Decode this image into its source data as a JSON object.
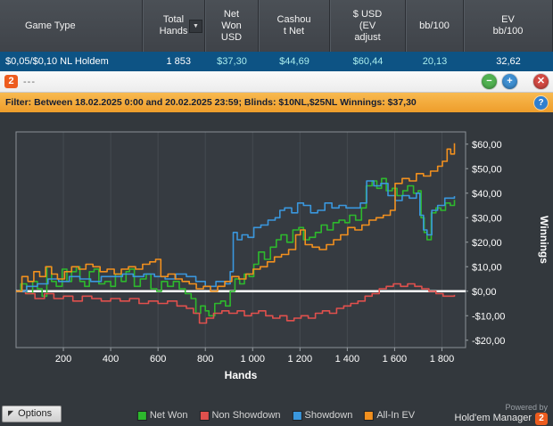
{
  "table": {
    "columns": [
      "Game Type",
      "Total\nHands",
      "Net\nWon\nUSD",
      "Cashou\nt Net",
      "$ USD\n(EV\nadjust",
      "bb/100",
      "EV\nbb/100"
    ],
    "sort_glyph": "▼",
    "row": [
      "$0,05/$0,10 NL Holdem",
      "1 853",
      "$37,30",
      "$44,69",
      "$60,44",
      "20,13",
      "32,62"
    ]
  },
  "toolbar": {
    "app_badge": "2",
    "title": "---",
    "minus_glyph": "−",
    "plus_glyph": "+",
    "close_glyph": "✕"
  },
  "filter_bar": {
    "label": "Filter: Between 18.02.2025 0:00 and 20.02.2025 23:59; Blinds: $10NL,$25NL Winnings: $37,30",
    "help_glyph": "?"
  },
  "chart_data": {
    "type": "line",
    "title": "",
    "xlabel": "Hands",
    "ylabel": "Winnings",
    "xlim": [
      0,
      1900
    ],
    "ylim": [
      -23,
      65
    ],
    "grid": "vertical-only",
    "zero_line_color": "#ffffff",
    "plot_bg": "#363b41",
    "grid_color": "#454b51",
    "border_color": "#8b9198",
    "legend_position": "bottom",
    "x_ticks": [
      {
        "value": 200,
        "label": "200"
      },
      {
        "value": 400,
        "label": "400"
      },
      {
        "value": 600,
        "label": "600"
      },
      {
        "value": 800,
        "label": "800"
      },
      {
        "value": 1000,
        "label": "1 000"
      },
      {
        "value": 1200,
        "label": "1 200"
      },
      {
        "value": 1400,
        "label": "1 400"
      },
      {
        "value": 1600,
        "label": "1 600"
      },
      {
        "value": 1800,
        "label": "1 800"
      }
    ],
    "y_ticks": [
      {
        "value": 60,
        "label": "$60,00"
      },
      {
        "value": 50,
        "label": "$50,00"
      },
      {
        "value": 40,
        "label": "$40,00"
      },
      {
        "value": 30,
        "label": "$30,00"
      },
      {
        "value": 20,
        "label": "$20,00"
      },
      {
        "value": 10,
        "label": "$10,00"
      },
      {
        "value": 0,
        "label": "$0,00"
      },
      {
        "value": -10,
        "label": "-$10,00"
      },
      {
        "value": -20,
        "label": "-$20,00"
      }
    ],
    "series": [
      {
        "name": "Net Won",
        "color": "#2db92d",
        "final_value": 37.3,
        "points": [
          [
            0,
            0
          ],
          [
            20,
            3
          ],
          [
            45,
            -1
          ],
          [
            70,
            4
          ],
          [
            90,
            1
          ],
          [
            110,
            -2
          ],
          [
            130,
            10
          ],
          [
            150,
            4
          ],
          [
            170,
            2
          ],
          [
            195,
            9
          ],
          [
            215,
            4
          ],
          [
            235,
            8
          ],
          [
            255,
            10
          ],
          [
            270,
            4
          ],
          [
            290,
            2
          ],
          [
            310,
            8
          ],
          [
            330,
            9
          ],
          [
            350,
            3
          ],
          [
            375,
            4
          ],
          [
            400,
            2
          ],
          [
            420,
            7
          ],
          [
            445,
            4
          ],
          [
            465,
            8
          ],
          [
            480,
            9
          ],
          [
            500,
            2
          ],
          [
            525,
            5
          ],
          [
            550,
            7
          ],
          [
            570,
            1
          ],
          [
            595,
            0
          ],
          [
            615,
            4
          ],
          [
            640,
            2
          ],
          [
            665,
            4
          ],
          [
            690,
            1
          ],
          [
            715,
            -1
          ],
          [
            740,
            -3
          ],
          [
            760,
            -9
          ],
          [
            780,
            -6
          ],
          [
            800,
            -8
          ],
          [
            815,
            -10
          ],
          [
            840,
            -5
          ],
          [
            865,
            -4
          ],
          [
            885,
            -6
          ],
          [
            905,
            0
          ],
          [
            925,
            5
          ],
          [
            945,
            3
          ],
          [
            965,
            7
          ],
          [
            985,
            6
          ],
          [
            1005,
            11
          ],
          [
            1025,
            16
          ],
          [
            1050,
            13
          ],
          [
            1075,
            18
          ],
          [
            1100,
            21
          ],
          [
            1120,
            23
          ],
          [
            1145,
            20
          ],
          [
            1170,
            25
          ],
          [
            1195,
            26
          ],
          [
            1215,
            21
          ],
          [
            1240,
            22
          ],
          [
            1265,
            24
          ],
          [
            1290,
            27
          ],
          [
            1315,
            25
          ],
          [
            1340,
            28
          ],
          [
            1365,
            29
          ],
          [
            1390,
            28
          ],
          [
            1410,
            31
          ],
          [
            1435,
            29
          ],
          [
            1460,
            34
          ],
          [
            1480,
            43
          ],
          [
            1505,
            45
          ],
          [
            1525,
            42
          ],
          [
            1545,
            46
          ],
          [
            1565,
            41
          ],
          [
            1590,
            42
          ],
          [
            1610,
            39
          ],
          [
            1635,
            41
          ],
          [
            1655,
            43
          ],
          [
            1680,
            40
          ],
          [
            1700,
            41
          ],
          [
            1712,
            30
          ],
          [
            1725,
            24
          ],
          [
            1737,
            21
          ],
          [
            1755,
            32
          ],
          [
            1775,
            34
          ],
          [
            1795,
            33
          ],
          [
            1815,
            36
          ],
          [
            1835,
            35
          ],
          [
            1853,
            37.3
          ]
        ]
      },
      {
        "name": "Non Showdown",
        "color": "#e0504d",
        "points": [
          [
            0,
            0
          ],
          [
            40,
            -1
          ],
          [
            80,
            -3
          ],
          [
            120,
            -1
          ],
          [
            160,
            -3
          ],
          [
            200,
            -2
          ],
          [
            240,
            -4
          ],
          [
            280,
            -2
          ],
          [
            320,
            -3
          ],
          [
            360,
            -4
          ],
          [
            400,
            -3
          ],
          [
            440,
            -4
          ],
          [
            480,
            -3
          ],
          [
            520,
            -5
          ],
          [
            560,
            -4
          ],
          [
            600,
            -5
          ],
          [
            640,
            -4
          ],
          [
            680,
            -6
          ],
          [
            720,
            -7
          ],
          [
            750,
            -9
          ],
          [
            775,
            -13
          ],
          [
            805,
            -11
          ],
          [
            835,
            -9
          ],
          [
            870,
            -8
          ],
          [
            900,
            -9
          ],
          [
            935,
            -8
          ],
          [
            965,
            -10
          ],
          [
            995,
            -9
          ],
          [
            1025,
            -8
          ],
          [
            1055,
            -10
          ],
          [
            1085,
            -11
          ],
          [
            1115,
            -10
          ],
          [
            1145,
            -12
          ],
          [
            1175,
            -11
          ],
          [
            1205,
            -10
          ],
          [
            1235,
            -11
          ],
          [
            1265,
            -9
          ],
          [
            1295,
            -8
          ],
          [
            1325,
            -9
          ],
          [
            1355,
            -7
          ],
          [
            1385,
            -6
          ],
          [
            1415,
            -5
          ],
          [
            1445,
            -4
          ],
          [
            1475,
            -2
          ],
          [
            1505,
            -1
          ],
          [
            1535,
            1
          ],
          [
            1565,
            2
          ],
          [
            1595,
            3
          ],
          [
            1625,
            2
          ],
          [
            1655,
            3
          ],
          [
            1685,
            2
          ],
          [
            1715,
            1
          ],
          [
            1745,
            0
          ],
          [
            1775,
            -1
          ],
          [
            1805,
            -2
          ],
          [
            1853,
            -1.5
          ]
        ]
      },
      {
        "name": "Showdown",
        "color": "#3a97dd",
        "points": [
          [
            0,
            0
          ],
          [
            45,
            2
          ],
          [
            90,
            3
          ],
          [
            135,
            5
          ],
          [
            180,
            4
          ],
          [
            225,
            6
          ],
          [
            270,
            5
          ],
          [
            315,
            4
          ],
          [
            360,
            6
          ],
          [
            405,
            6
          ],
          [
            450,
            7
          ],
          [
            495,
            6
          ],
          [
            540,
            7
          ],
          [
            585,
            6
          ],
          [
            630,
            5
          ],
          [
            675,
            7
          ],
          [
            720,
            6
          ],
          [
            760,
            4
          ],
          [
            800,
            2
          ],
          [
            845,
            4
          ],
          [
            885,
            3
          ],
          [
            905,
            8
          ],
          [
            918,
            24
          ],
          [
            935,
            21
          ],
          [
            955,
            23
          ],
          [
            980,
            22
          ],
          [
            1005,
            26
          ],
          [
            1035,
            27
          ],
          [
            1065,
            29
          ],
          [
            1095,
            30
          ],
          [
            1115,
            33
          ],
          [
            1135,
            34
          ],
          [
            1165,
            32
          ],
          [
            1190,
            36
          ],
          [
            1215,
            35
          ],
          [
            1245,
            32
          ],
          [
            1275,
            33
          ],
          [
            1305,
            36
          ],
          [
            1335,
            34
          ],
          [
            1365,
            35
          ],
          [
            1395,
            34
          ],
          [
            1425,
            34
          ],
          [
            1455,
            36
          ],
          [
            1482,
            45
          ],
          [
            1512,
            43
          ],
          [
            1542,
            44
          ],
          [
            1572,
            39
          ],
          [
            1602,
            37
          ],
          [
            1632,
            39
          ],
          [
            1662,
            38
          ],
          [
            1692,
            40
          ],
          [
            1707,
            31
          ],
          [
            1722,
            25
          ],
          [
            1737,
            23
          ],
          [
            1757,
            33
          ],
          [
            1782,
            35
          ],
          [
            1812,
            38
          ],
          [
            1853,
            38.8
          ]
        ]
      },
      {
        "name": "All-In EV",
        "color": "#f2901e",
        "final_value": 60.44,
        "points": [
          [
            0,
            0
          ],
          [
            25,
            6
          ],
          [
            50,
            4
          ],
          [
            75,
            8
          ],
          [
            100,
            6
          ],
          [
            125,
            10
          ],
          [
            150,
            7
          ],
          [
            175,
            5
          ],
          [
            205,
            8
          ],
          [
            235,
            10
          ],
          [
            265,
            9
          ],
          [
            295,
            11
          ],
          [
            325,
            10
          ],
          [
            355,
            8
          ],
          [
            385,
            9
          ],
          [
            415,
            7
          ],
          [
            445,
            9
          ],
          [
            475,
            10
          ],
          [
            505,
            9
          ],
          [
            535,
            11
          ],
          [
            565,
            12
          ],
          [
            590,
            13
          ],
          [
            612,
            6
          ],
          [
            642,
            7
          ],
          [
            672,
            5
          ],
          [
            702,
            4
          ],
          [
            732,
            3
          ],
          [
            762,
            1
          ],
          [
            792,
            2
          ],
          [
            822,
            0
          ],
          [
            852,
            2
          ],
          [
            882,
            4
          ],
          [
            912,
            6
          ],
          [
            942,
            5
          ],
          [
            972,
            7
          ],
          [
            1002,
            9
          ],
          [
            1032,
            10
          ],
          [
            1062,
            12
          ],
          [
            1092,
            14
          ],
          [
            1122,
            15
          ],
          [
            1152,
            17
          ],
          [
            1182,
            23
          ],
          [
            1202,
            25
          ],
          [
            1222,
            19
          ],
          [
            1252,
            18
          ],
          [
            1282,
            17
          ],
          [
            1312,
            19
          ],
          [
            1342,
            21
          ],
          [
            1372,
            23
          ],
          [
            1402,
            26
          ],
          [
            1432,
            25
          ],
          [
            1462,
            27
          ],
          [
            1492,
            29
          ],
          [
            1522,
            30
          ],
          [
            1552,
            31
          ],
          [
            1582,
            33
          ],
          [
            1602,
            44
          ],
          [
            1632,
            46
          ],
          [
            1662,
            45
          ],
          [
            1692,
            48
          ],
          [
            1722,
            47
          ],
          [
            1752,
            49
          ],
          [
            1782,
            51
          ],
          [
            1802,
            53
          ],
          [
            1822,
            58
          ],
          [
            1837,
            56
          ],
          [
            1853,
            60.4
          ]
        ]
      }
    ]
  },
  "footer": {
    "options_label": "Options",
    "options_glyph": "◤",
    "powered_by": "Powered by",
    "brand": "Hold'em Manager",
    "brand_badge": "2"
  }
}
